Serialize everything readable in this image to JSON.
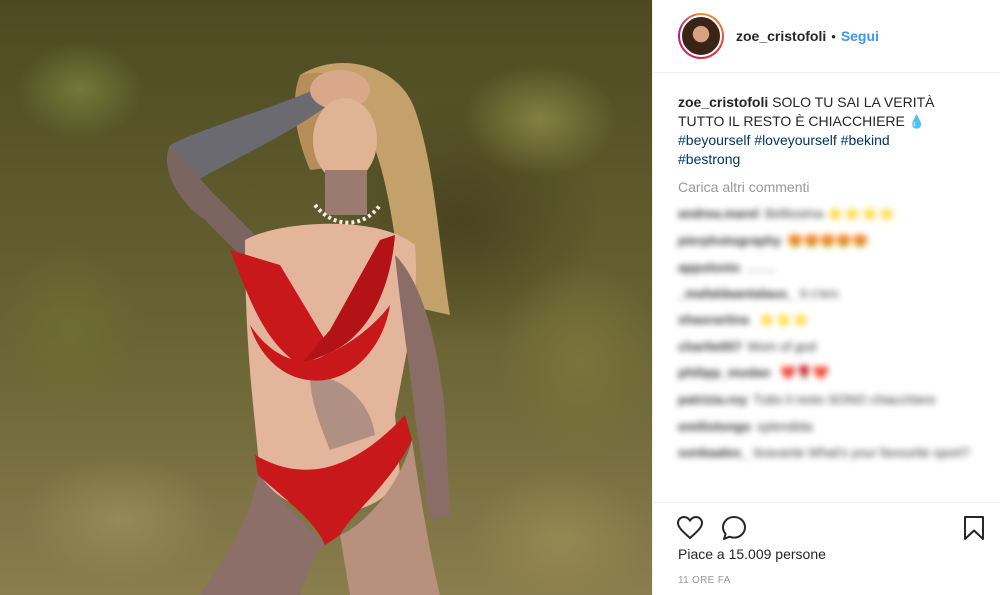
{
  "post": {
    "username": "zoe_cristofoli",
    "separator": "•",
    "follow_label": "Segui"
  },
  "caption": {
    "username": "zoe_cristofoli",
    "text": "SOLO TU SAI LA VERITÀ TUTTO IL RESTO È CHIACCHIERE",
    "emoji": "💧",
    "hashtags": [
      "#beyourself",
      "#loveyourself",
      "#bekind",
      "#bestrong"
    ]
  },
  "load_more_label": "Carica altri commenti",
  "comments": [
    {
      "user": "andrea.marel",
      "text": "Bellissima",
      "emoji": "⭐⭐⭐⭐"
    },
    {
      "user": "pierphotography",
      "text": "😍😍😍😍😍",
      "emoji": ""
    },
    {
      "user": "appolonio",
      "text": "........",
      "emoji": ""
    },
    {
      "user": "_mafaldaantalaus_",
      "text": "ti c'ero",
      "emoji": ""
    },
    {
      "user": "shaorartina",
      "text": "",
      "emoji": "⭐⭐⭐"
    },
    {
      "user": "charlie007",
      "text": "Mom of god",
      "emoji": ""
    },
    {
      "user": "philipp_modan",
      "text": "",
      "emoji": "❤️🌹❤️"
    },
    {
      "user": "patrizia.roy",
      "text": "Tutto il resto SONO chiacchiere",
      "emoji": ""
    },
    {
      "user": "emiliolongo",
      "text": "splendida",
      "emoji": ""
    },
    {
      "user": "sonkaalex_",
      "text": "bravante What's your favourite sport?",
      "emoji": ""
    }
  ],
  "actions": {
    "like_icon": "heart-outline-icon",
    "comment_icon": "comment-bubble-icon",
    "save_icon": "bookmark-icon"
  },
  "likes_text": "Piace a 15.009 persone",
  "timestamp": "11 ORE FA",
  "colors": {
    "link": "#3897f0",
    "hashtag": "#003569",
    "muted": "#999999",
    "bikini": "#c8181c"
  }
}
